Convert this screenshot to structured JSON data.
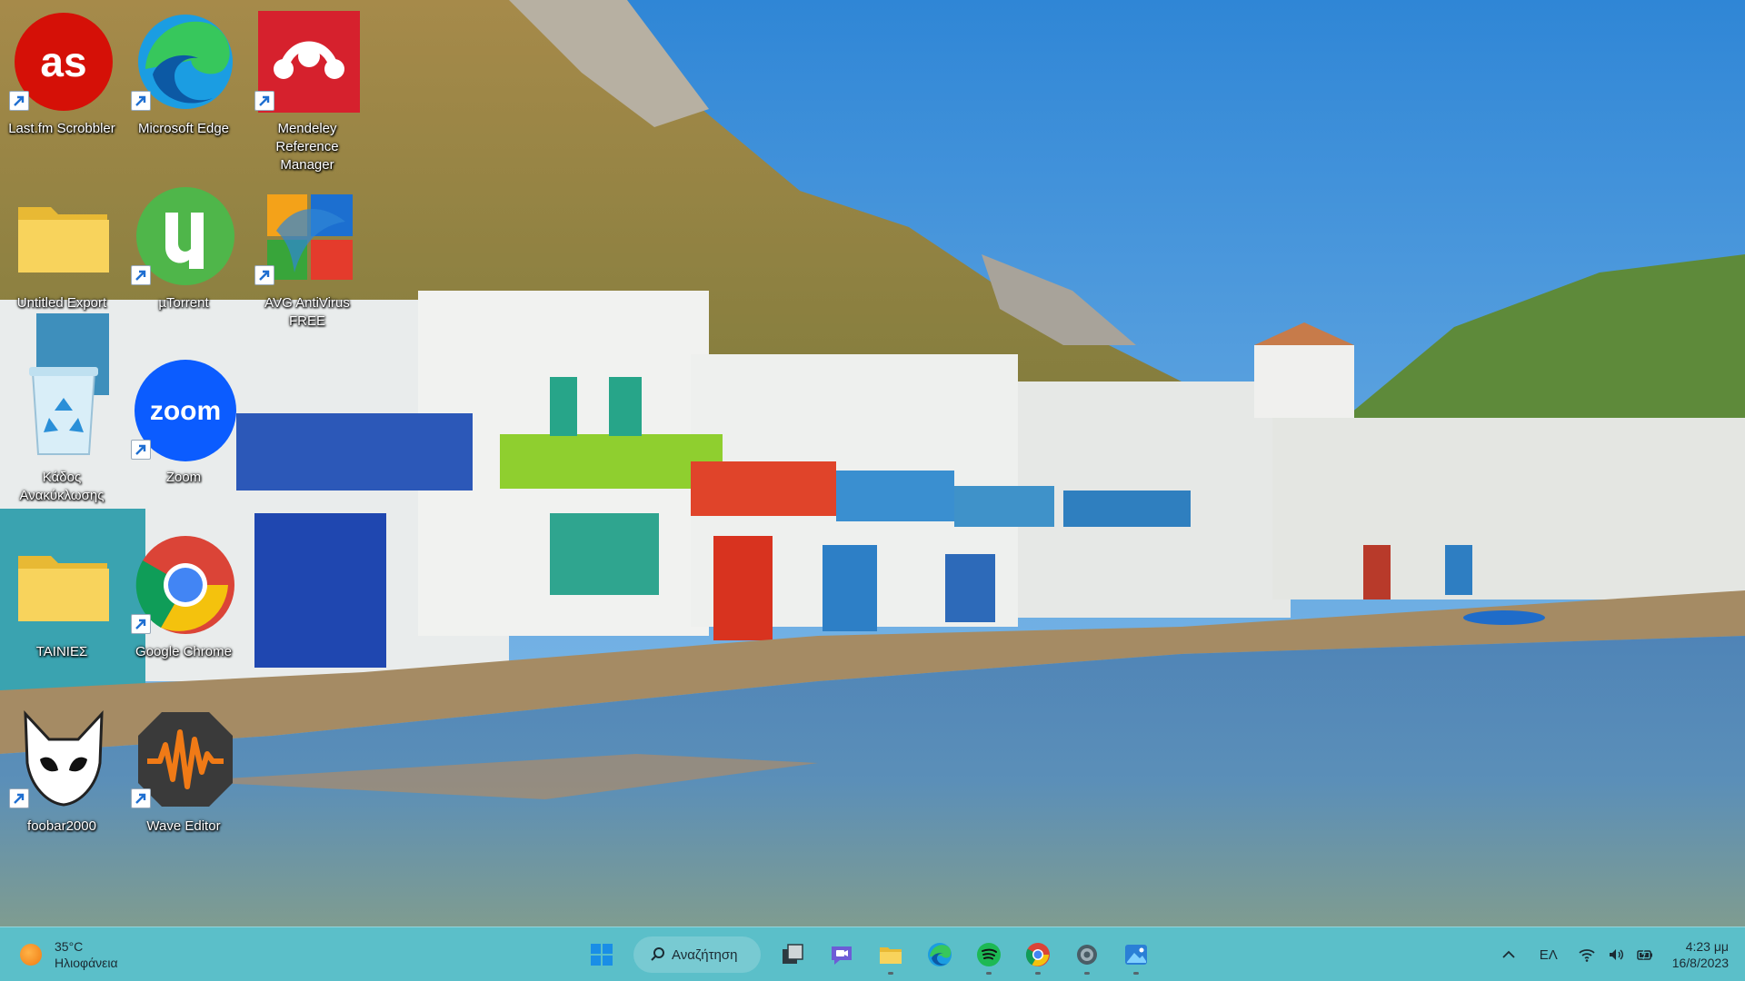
{
  "desktop": {
    "icons": [
      {
        "label": "Last.fm Scrobbler",
        "icon": "lastfm-icon"
      },
      {
        "label": "Microsoft Edge",
        "icon": "edge-icon"
      },
      {
        "label": "Mendeley Reference Manager",
        "icon": "mendeley-icon"
      },
      {
        "label": "Untitled Export",
        "icon": "folder-icon"
      },
      {
        "label": "µTorrent",
        "icon": "utorrent-icon"
      },
      {
        "label": "AVG AntiVirus FREE",
        "icon": "avg-icon"
      },
      {
        "label": "Κάδος Ανακύκλωσης",
        "icon": "recycle-bin-icon"
      },
      {
        "label": "Zoom",
        "icon": "zoom-icon"
      },
      {
        "label": "ΤΑΙΝΙΕΣ",
        "icon": "folder-icon"
      },
      {
        "label": "Google Chrome",
        "icon": "chrome-icon"
      },
      {
        "label": "foobar2000",
        "icon": "foobar2000-icon"
      },
      {
        "label": "Wave Editor",
        "icon": "wave-editor-icon"
      }
    ],
    "zoom_logo_text": "zoom"
  },
  "taskbar": {
    "weather": {
      "temperature": "35°C",
      "condition": "Ηλιοφάνεια"
    },
    "search_label": "Αναζήτηση",
    "pinned": [
      "start-icon",
      "search-icon",
      "task-view-icon",
      "teams-chat-icon",
      "file-explorer-icon",
      "edge-icon",
      "spotify-icon",
      "chrome-icon",
      "settings-icon",
      "photos-icon"
    ],
    "tray": {
      "language": "ΕΛ",
      "time": "4:23 μμ",
      "date": "16/8/2023"
    }
  },
  "colors": {
    "taskbar": "#5bbfc9",
    "sky": "#3c8fd8",
    "sea": "#4c86b8"
  }
}
